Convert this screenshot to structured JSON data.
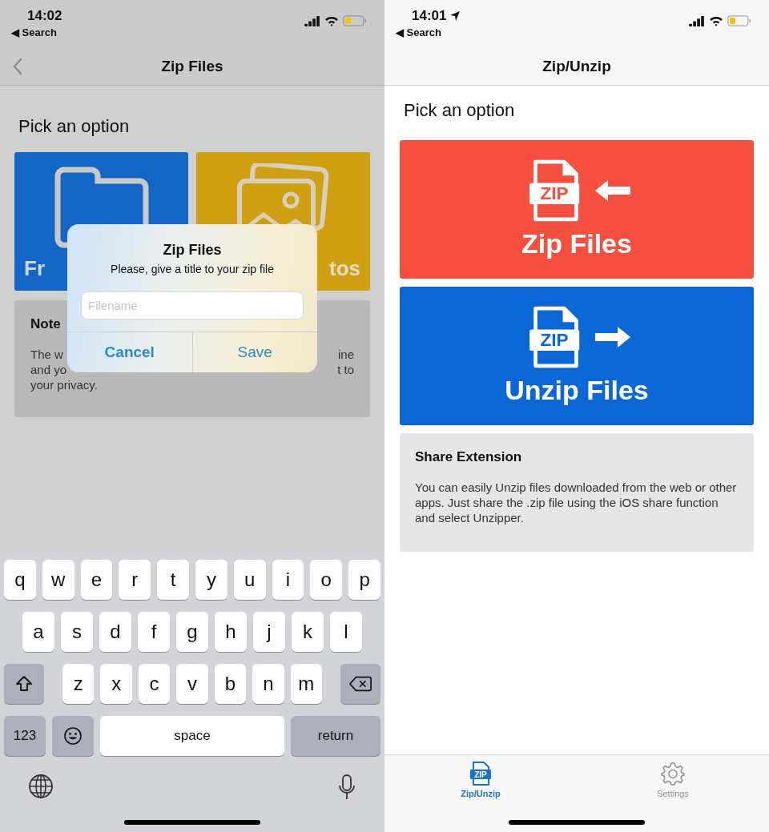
{
  "left_screen": {
    "status_bar": {
      "time": "14:02",
      "back_link": "◀ Search"
    },
    "nav": {
      "title": "Zip Files"
    },
    "heading": "Pick an option",
    "tiles": [
      {
        "label": "Fr",
        "kind": "files"
      },
      {
        "label": "tos",
        "kind": "photos"
      }
    ],
    "note": {
      "title": "Note",
      "lines": [
        {
          "left": "The w",
          "right": "ine"
        },
        {
          "left": "and yo",
          "right": "t to"
        },
        {
          "left": "your privacy."
        }
      ]
    },
    "dialog": {
      "title": "Zip Files",
      "message": "Please, give a title to your zip file",
      "field": {
        "placeholder": "Filename"
      },
      "buttons": [
        {
          "label": "Cancel",
          "kind": "cancel"
        },
        {
          "label": "Save",
          "kind": "save"
        }
      ]
    },
    "keyboard": {
      "rows": [
        {
          "keys": [
            {
              "label": "q",
              "kind": "letter"
            },
            {
              "label": "w",
              "kind": "letter"
            },
            {
              "label": "e",
              "kind": "letter"
            },
            {
              "label": "r",
              "kind": "letter"
            },
            {
              "label": "t",
              "kind": "letter"
            },
            {
              "label": "y",
              "kind": "letter"
            },
            {
              "label": "u",
              "kind": "letter"
            },
            {
              "label": "i",
              "kind": "letter"
            },
            {
              "label": "o",
              "kind": "letter"
            },
            {
              "label": "p",
              "kind": "letter"
            }
          ]
        },
        {
          "keys": [
            {
              "label": "a",
              "kind": "letter"
            },
            {
              "label": "s",
              "kind": "letter"
            },
            {
              "label": "d",
              "kind": "letter"
            },
            {
              "label": "f",
              "kind": "letter"
            },
            {
              "label": "g",
              "kind": "letter"
            },
            {
              "label": "h",
              "kind": "letter"
            },
            {
              "label": "j",
              "kind": "letter"
            },
            {
              "label": "k",
              "kind": "letter"
            },
            {
              "label": "l",
              "kind": "letter"
            }
          ]
        },
        {
          "keys": [
            {
              "kind": "shift"
            },
            {
              "label": "z",
              "kind": "letter"
            },
            {
              "label": "x",
              "kind": "letter"
            },
            {
              "label": "c",
              "kind": "letter"
            },
            {
              "label": "v",
              "kind": "letter"
            },
            {
              "label": "b",
              "kind": "letter"
            },
            {
              "label": "n",
              "kind": "letter"
            },
            {
              "label": "m",
              "kind": "letter"
            },
            {
              "kind": "delete"
            }
          ]
        },
        {
          "keys": [
            {
              "label": "123",
              "kind": "numbers"
            },
            {
              "kind": "emoji"
            },
            {
              "label": "space",
              "kind": "space"
            },
            {
              "label": "return",
              "kind": "return"
            }
          ]
        }
      ]
    }
  },
  "right_screen": {
    "status_bar": {
      "time": "14:01",
      "back_link": "◀ Search"
    },
    "nav": {
      "title": "Zip/Unzip"
    },
    "heading": "Pick an option",
    "actions": [
      {
        "label": "Zip Files",
        "kind": "zip",
        "icon_text": "ZIP"
      },
      {
        "label": "Unzip Files",
        "kind": "unzip",
        "icon_text": "ZIP"
      }
    ],
    "info": {
      "title": "Share Extension",
      "text": "You can easily Unzip files downloaded from the web or other apps. Just share the .zip file using the iOS share function and select Unzipper."
    },
    "tab_bar": {
      "items": [
        {
          "label": "Zip/Unzip",
          "kind": "zip",
          "icon_text": "ZIP",
          "selected": true
        },
        {
          "label": "Settings",
          "kind": "settings",
          "selected": false
        }
      ]
    }
  }
}
